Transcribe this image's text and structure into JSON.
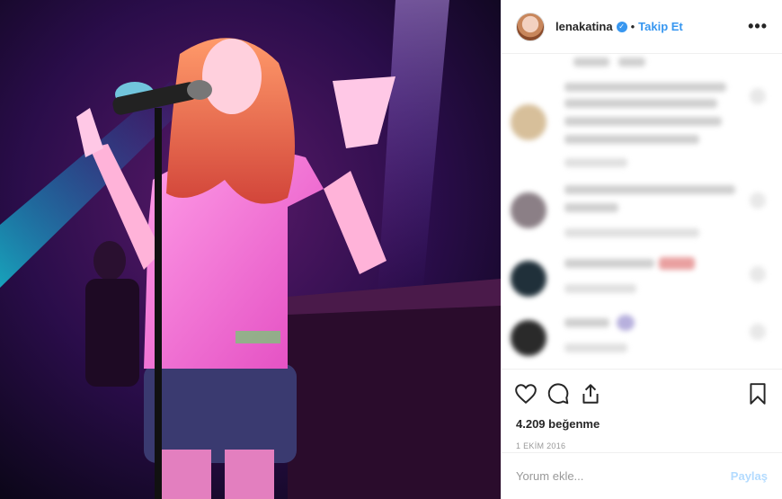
{
  "post": {
    "photo_icon": "concert-photo",
    "username": "lenakatina",
    "verified_icon": "verified-badge-icon",
    "separator": "•",
    "follow_label": "Takip Et",
    "more_label": "•••",
    "likes_text": "4.209 beğenme",
    "date_text": "1 EKİM 2016",
    "comment_placeholder": "Yorum ekle...",
    "share_label": "Paylaş"
  },
  "colors": {
    "accent": "#3897f0",
    "share_disabled": "#b3dbff",
    "border": "#efefef"
  }
}
